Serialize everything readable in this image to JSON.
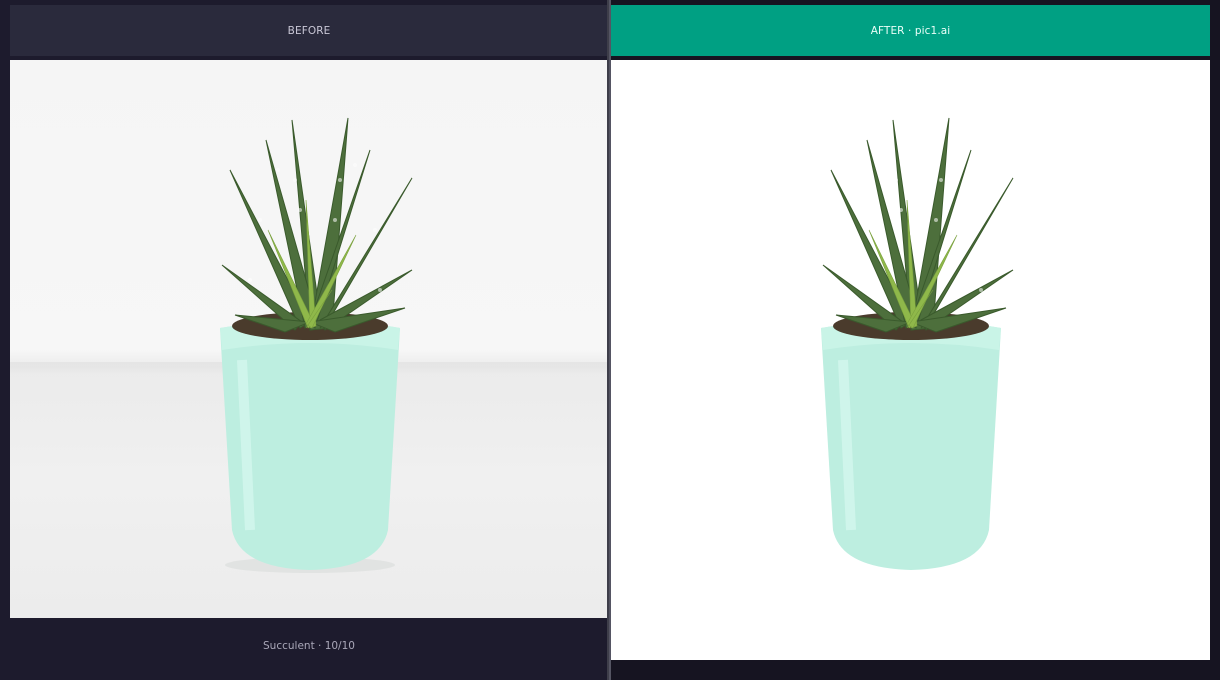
{
  "before_panel": {
    "header_label": "BEFORE",
    "caption": "Succulent · 10/10"
  },
  "after_panel": {
    "header_label": "AFTER · pic1.ai"
  },
  "colors": {
    "after_header_bg": "#00a083",
    "before_header_bg": "#2a2a3c",
    "pot_color": "#bdeee0",
    "leaf_color": "#4a6b3a"
  }
}
